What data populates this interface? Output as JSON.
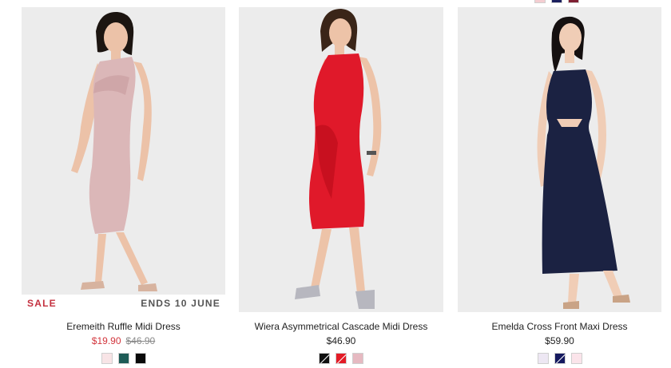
{
  "top_swatches": [
    {
      "color": "#f4cdd1"
    },
    {
      "color": "#1b1f5e"
    },
    {
      "color": "#7e1f32"
    }
  ],
  "products": [
    {
      "name": "Eremeith Ruffle Midi Dress",
      "sale_price": "$19.90",
      "original_price": "$46.90",
      "badge": {
        "sale": "SALE",
        "ends": "ENDS 10 JUNE"
      },
      "image": {
        "dress_color": "#dbb7b8",
        "skin": "#ecc2a8"
      },
      "swatches": [
        {
          "color": "#f8e4e6",
          "selected": false
        },
        {
          "color": "#1e5b56",
          "selected": false
        },
        {
          "color": "#0a0a0a",
          "selected": false
        }
      ]
    },
    {
      "name": "Wiera Asymmetrical Cascade Midi Dress",
      "price": "$46.90",
      "image": {
        "dress_color": "#e0192a",
        "skin": "#edc3a8"
      },
      "swatches": [
        {
          "color": "#111111",
          "selected": true
        },
        {
          "color": "#e31b26",
          "selected": true
        },
        {
          "color": "#e6b9c1",
          "selected": false
        }
      ]
    },
    {
      "name": "Emelda Cross Front Maxi Dress",
      "price": "$59.90",
      "image": {
        "dress_color": "#1b2242",
        "skin": "#f0cdb6"
      },
      "swatches": [
        {
          "color": "#ede7f3",
          "selected": false
        },
        {
          "color": "#15195f",
          "selected": true
        },
        {
          "color": "#fbe4ea",
          "selected": false
        }
      ]
    }
  ]
}
